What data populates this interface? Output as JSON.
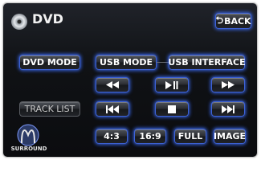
{
  "header": {
    "title": "DVD",
    "back_label": "BACK",
    "back_arrow": "⮌"
  },
  "left": {
    "dvd_mode": "DVD MODE",
    "track_list": "TRACK LIST",
    "surround": "SURROUND"
  },
  "source": {
    "usb_mode": "USB MODE",
    "usb_interface": "USB INTERFACE"
  },
  "transport": {
    "rewind_icon": "rewind-icon",
    "play_pause_icon": "play-pause-icon",
    "fast_forward_icon": "fast-forward-icon",
    "prev_icon": "skip-previous-icon",
    "stop_icon": "stop-icon",
    "next_icon": "skip-next-icon"
  },
  "aspect": {
    "ratio_4_3": "4:3",
    "ratio_16_9": "16:9",
    "full": "FULL",
    "image": "IMAGE"
  },
  "colors": {
    "accent_glow": "#3e63d8",
    "background": "#0f1114",
    "text": "#ffffff"
  }
}
